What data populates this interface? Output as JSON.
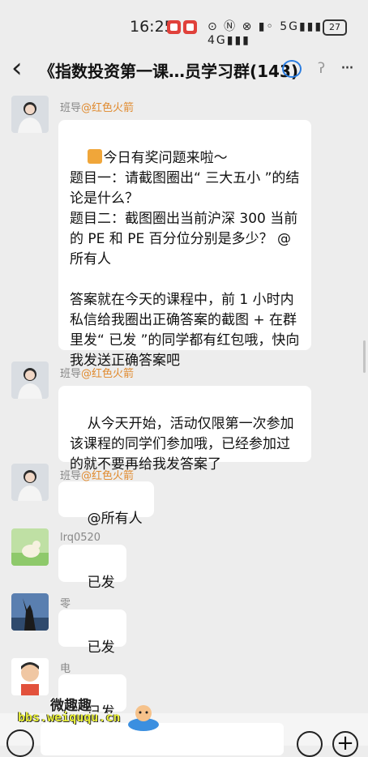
{
  "status_bar": {
    "time": "16:25",
    "network_icons": "⊙ Ⓝ ⊗ ▮◦ 5G▮▮▮ 4G▮▮▮",
    "battery": "27"
  },
  "header": {
    "title": "《指数投资第一课…员学习群(143)",
    "back_icon": "back-arrow-icon",
    "more_label": "···"
  },
  "messages": [
    {
      "sender": "班导",
      "sender_tag": "@红色火箭",
      "text": "今日有奖问题来啦～\n题目一：请截图圈出“ 三大五小 ”的结论是什么？\n题目二：截图圈出当前沪深 300 当前的 PE 和 PE 百分位分别是多少？ @所有人\n\n答案就在今天的课程中，前 1 小时内私信给我圈出正确答案的截图 + 在群里发“ 已发 ”的同学都有红包哦，快向我发送正确答案吧",
      "emoji1": "gift-icon",
      "emoji2": "red-envelope-icon"
    },
    {
      "sender": "班导",
      "sender_tag": "@红色火箭",
      "text": "从今天开始，活动仅限第一次参加该课程的同学们参加哦，已经参加过的就不要再给我发答案了"
    },
    {
      "sender": "班导",
      "sender_tag": "@红色火箭",
      "text": "@所有人"
    },
    {
      "sender": "lrq0520",
      "text": "已发"
    },
    {
      "sender": "零",
      "text": "已发"
    },
    {
      "sender": "电",
      "text": "已发"
    }
  ],
  "watermark": {
    "line1": "微趣趣",
    "line2": "bbs.weiququ.cn"
  },
  "colors": {
    "background": "#ededed",
    "bubble": "#ffffff",
    "tag": "#e08a2e",
    "notif": "#e0413b"
  }
}
